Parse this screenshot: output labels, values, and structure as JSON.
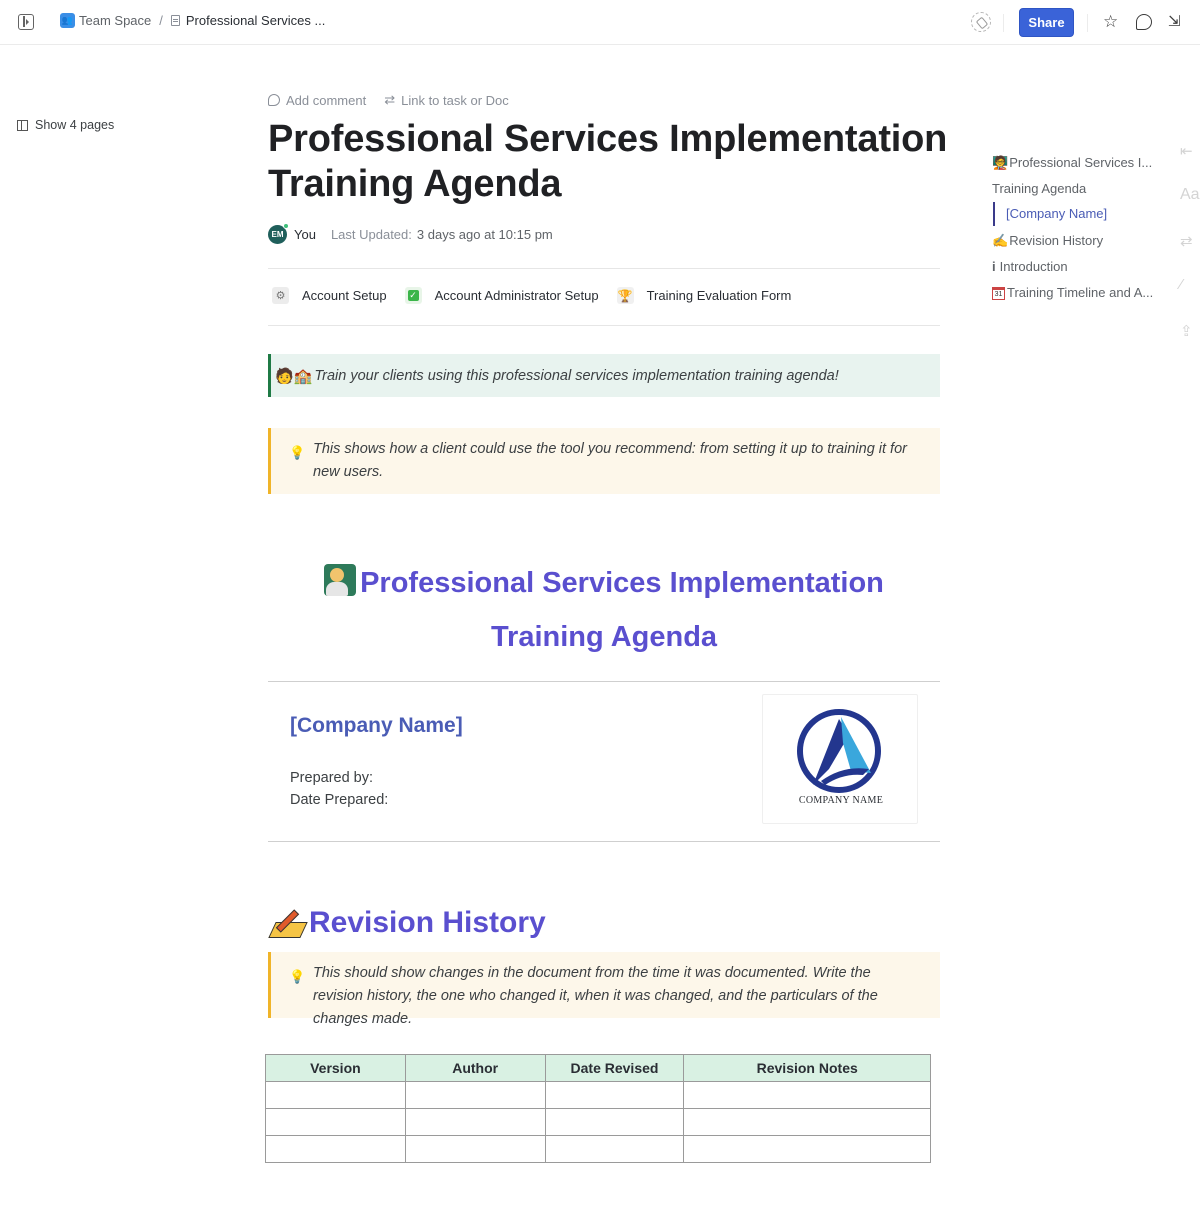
{
  "topbar": {
    "breadcrumb": {
      "space": "Team Space",
      "separator": "/",
      "doc": "Professional Services ..."
    },
    "share_label": "Share"
  },
  "left": {
    "show_pages": "Show 4 pages"
  },
  "doc": {
    "actions": {
      "add_comment": "Add comment",
      "link_task": "Link to task or Doc"
    },
    "title": "Professional Services Implementation Training Agenda",
    "meta": {
      "avatar_initials": "EM",
      "author": "You",
      "updated_label": "Last Updated:",
      "updated_value": "3 days ago at 10:15 pm"
    },
    "linked_pages": [
      {
        "icon": "gear-icon",
        "label": "Account Setup"
      },
      {
        "icon": "check-icon",
        "label": "Account Administrator Setup"
      },
      {
        "icon": "trophy-icon",
        "label": "Training Evaluation Form"
      }
    ],
    "banner": {
      "emoji": "🧑🏫",
      "text": "Train your clients using this professional services implementation training agenda!"
    },
    "tip1": "This shows how a client could use the tool you recommend: from setting it up to training it for new users.",
    "heading_main": "Professional Services Implementation Training Agenda",
    "company_name": "[Company Name]",
    "prepared_by": "Prepared by:",
    "date_prepared": "Date Prepared:",
    "logo_text": "COMPANY NAME",
    "revision": {
      "heading": "Revision History",
      "tip": "This should show changes in the document from the time it was documented. Write the revision history, the one who changed it, when it was changed, and the particulars of the changes made.",
      "columns": [
        "Version",
        "Author",
        "Date Revised",
        "Revision Notes"
      ],
      "rows": [
        [
          "",
          "",
          "",
          ""
        ],
        [
          "",
          "",
          "",
          ""
        ],
        [
          "",
          "",
          "",
          ""
        ]
      ]
    }
  },
  "toc": {
    "items": [
      {
        "label": "Professional Services I...",
        "icon": "teacher-icon"
      },
      {
        "label": "Training Agenda"
      },
      {
        "label": "[Company Name]",
        "sub": true
      },
      {
        "label": "Revision History",
        "icon": "writing-hand-icon"
      },
      {
        "label": "Introduction",
        "icon": "info-icon"
      },
      {
        "label": "Training Timeline and A...",
        "icon": "calendar-icon"
      }
    ]
  },
  "colors": {
    "accent": "#3a63d8",
    "heading": "#5a4fcf",
    "company": "#4a5cb5",
    "callout_green_border": "#1f7a45",
    "callout_yellow_border": "#f0b429",
    "table_header": "#d9f1e3"
  }
}
